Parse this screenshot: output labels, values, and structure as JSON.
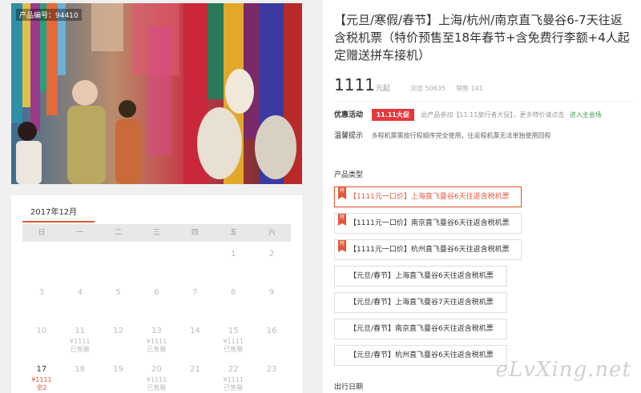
{
  "hero": {
    "product_no": "产品编号：94410"
  },
  "calendar": {
    "month_tab": "2017年12月",
    "weekdays": [
      "日",
      "一",
      "二",
      "三",
      "四",
      "五",
      "六"
    ],
    "rows": [
      [
        {
          "d": ""
        },
        {
          "d": ""
        },
        {
          "d": ""
        },
        {
          "d": ""
        },
        {
          "d": ""
        },
        {
          "d": "1"
        },
        {
          "d": "2"
        }
      ],
      [
        {
          "d": "3"
        },
        {
          "d": "4"
        },
        {
          "d": "5"
        },
        {
          "d": "6"
        },
        {
          "d": "7"
        },
        {
          "d": "8"
        },
        {
          "d": "9"
        }
      ],
      [
        {
          "d": "10"
        },
        {
          "d": "11",
          "p": "¥1111",
          "s": "已售罄"
        },
        {
          "d": "12"
        },
        {
          "d": "13",
          "p": "¥1111",
          "s": "已售罄"
        },
        {
          "d": "14"
        },
        {
          "d": "15",
          "p": "¥1111",
          "s": "已售罄"
        },
        {
          "d": "16"
        }
      ],
      [
        {
          "d": "17",
          "p": "¥1111",
          "s": "余2",
          "active": true
        },
        {
          "d": "18"
        },
        {
          "d": "19"
        },
        {
          "d": "20",
          "p": "¥1111",
          "s": "已售罄"
        },
        {
          "d": "21"
        },
        {
          "d": "22",
          "p": "¥1111",
          "s": "已售罄"
        },
        {
          "d": "23"
        }
      ]
    ]
  },
  "product": {
    "title": "【元旦/寒假/春节】上海/杭州/南京直飞曼谷6-7天往返含税机票（特价预售至18年春节+含免费行李额+4人起定赠送拼车接机）",
    "price": "1111",
    "price_unit": "元起",
    "views": "浏览 50635",
    "sales": "销售 141"
  },
  "promo": {
    "label": "优惠活动",
    "badge": "11.11大促",
    "text": "此产品参加【11.11旅行者大促】，更多特价请点击",
    "link": "进入主会场"
  },
  "tip": {
    "label": "温馨提示",
    "text": "多程机票需按行程顺序完全使用，往返程机票无法单独使用回程"
  },
  "types": {
    "label": "产品类型",
    "tag_char": "特",
    "options": [
      {
        "label": "【1111元一口价】上海直飞曼谷6天往返含税机票",
        "tagged": true,
        "selected": true
      },
      {
        "label": "【1111元一口价】南京直飞曼谷6天往返含税机票",
        "tagged": true,
        "selected": false
      },
      {
        "label": "【1111元一口价】杭州直飞曼谷6天往返含税机票",
        "tagged": true,
        "selected": false
      },
      {
        "label": "【元旦/春节】上海直飞曼谷6天往返含税机票",
        "tagged": false,
        "selected": false
      },
      {
        "label": "【元旦/春节】上海直飞曼谷7天往返含税机票",
        "tagged": false,
        "selected": false
      },
      {
        "label": "【元旦/春节】南京直飞曼谷6天往返含税机票",
        "tagged": false,
        "selected": false
      },
      {
        "label": "【元旦/春节】杭州直飞曼谷6天往返含税机票",
        "tagged": false,
        "selected": false
      }
    ]
  },
  "departure": {
    "label": "出行日期"
  },
  "watermark": "eLvXing.net",
  "colors": {
    "accent": "#e4593a",
    "promo_badge": "#e4393c",
    "link_green": "#3aa14a"
  }
}
